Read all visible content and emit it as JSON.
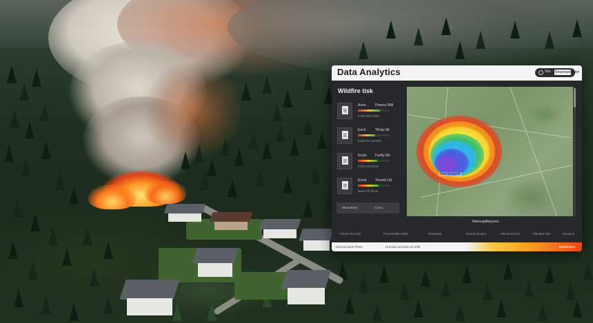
{
  "dashboard": {
    "title": "Data Analytics",
    "search": {
      "label": "Site",
      "value": "Revenuesfactor"
    },
    "panel_title": "Wildfire tisk",
    "risk_cards": [
      {
        "region": "Aooe",
        "level": "Fheevy Riltl",
        "meta": "lonite Risl Roke",
        "fill_pct": 70
      },
      {
        "region": "Eoch",
        "level": "Tlhaty ttlt",
        "meta": "savhs Ru Nenthe",
        "fill_pct": 55
      },
      {
        "region": "Eoulo",
        "level": "Fanlty ttst",
        "meta": "rnole Ctlc Buee",
        "fill_pct": 60
      },
      {
        "region": "Eocle",
        "level": "Tleoels Litt",
        "meta": "lanse Ptt flinve",
        "fill_pct": 65
      }
    ],
    "left_button": {
      "label": "Stineatioen",
      "value": "Crono"
    },
    "map": {
      "heat_label": "Nanoltedanth",
      "caption": "Nwwcaptllopyoss"
    },
    "metrics": [
      "Mtooh Rnn lbnt",
      "Prosuntellttn Rtlld",
      "Nontianttt",
      "Roudocrboshs",
      "Manolterioons",
      "Mandsie Ritt",
      "Morioloe"
    ],
    "footer": {
      "left": "Evtenensuen Plose",
      "mid": "Unnoleo an tndo tos Wlltt",
      "badge": "Relisbartiss"
    },
    "heat_colors": [
      "#e8401c",
      "#f6a51e",
      "#f2e23a",
      "#3ec06a",
      "#2fb6e6",
      "#4a5fe0",
      "#7a4ad8"
    ]
  }
}
